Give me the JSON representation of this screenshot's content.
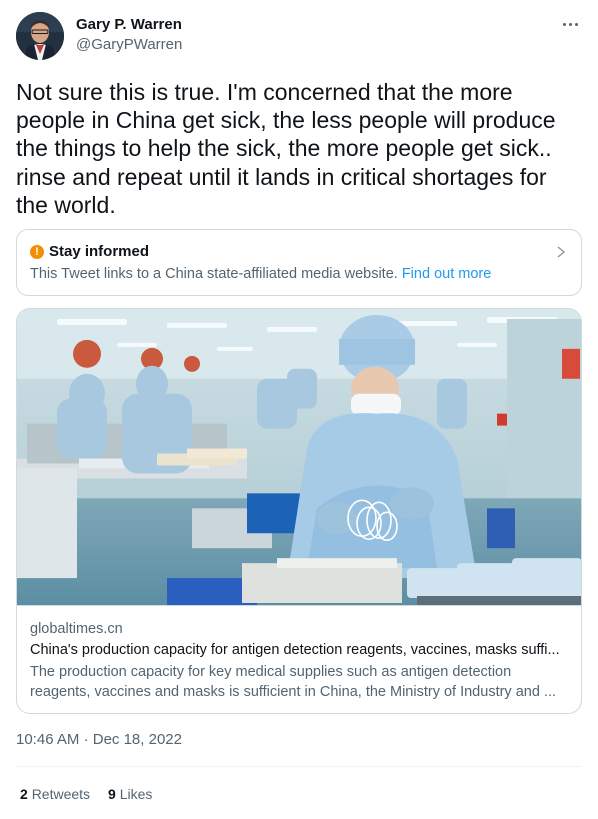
{
  "author": {
    "display_name": "Gary P. Warren",
    "handle": "@GaryPWarren"
  },
  "tweet": {
    "text": "Not sure this is true. I'm concerned that the more people in China get sick, the less people will produce the things to help the sick, the more people get sick.. rinse and repeat until it lands in critical shortages for the world."
  },
  "notice": {
    "title": "Stay informed",
    "body": "This Tweet links to a China state-affiliated media website.",
    "link": "Find out more"
  },
  "card": {
    "domain": "globaltimes.cn",
    "title": "China's production capacity for antigen detection reagents, vaccines, masks suffi...",
    "desc_line1": "The production capacity for key medical supplies such as antigen detection",
    "desc_line2": "reagents, vaccines and masks is sufficient in China, the Ministry of Industry and ..."
  },
  "timestamp": {
    "time": "10:46 AM",
    "sep": "·",
    "date": "Dec 18, 2022"
  },
  "stats": {
    "retweets_count": "2",
    "retweets_label": "Retweets",
    "likes_count": "9",
    "likes_label": "Likes"
  },
  "colors": {
    "text": "#0f1419",
    "secondary": "#536471",
    "link": "#1d9bf0",
    "border": "#cfd9de",
    "warning": "#f48c06"
  },
  "icons": [
    "more-icon",
    "warning-icon",
    "chevron-right-icon"
  ]
}
